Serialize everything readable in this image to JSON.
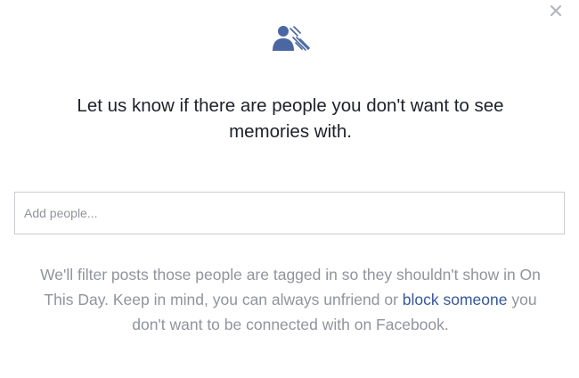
{
  "dialog": {
    "close_icon": "close-icon",
    "hero_icon": "people-hidden-icon",
    "prompt": "Let us know if there are people you don't want to see memories with.",
    "input": {
      "placeholder": "Add people...",
      "value": ""
    },
    "explain": {
      "before_link": "We'll filter posts those people are tagged in so they shouldn't show in On This Day. Keep in mind, you can always unfriend or ",
      "link_text": "block someone",
      "after_link": " you don't want to be connected with on Facebook."
    }
  },
  "colors": {
    "icon": "#4b67a1",
    "link": "#365899",
    "secondary_text": "#90949c",
    "primary_text": "#1d2129",
    "border": "#c9ccd1"
  }
}
